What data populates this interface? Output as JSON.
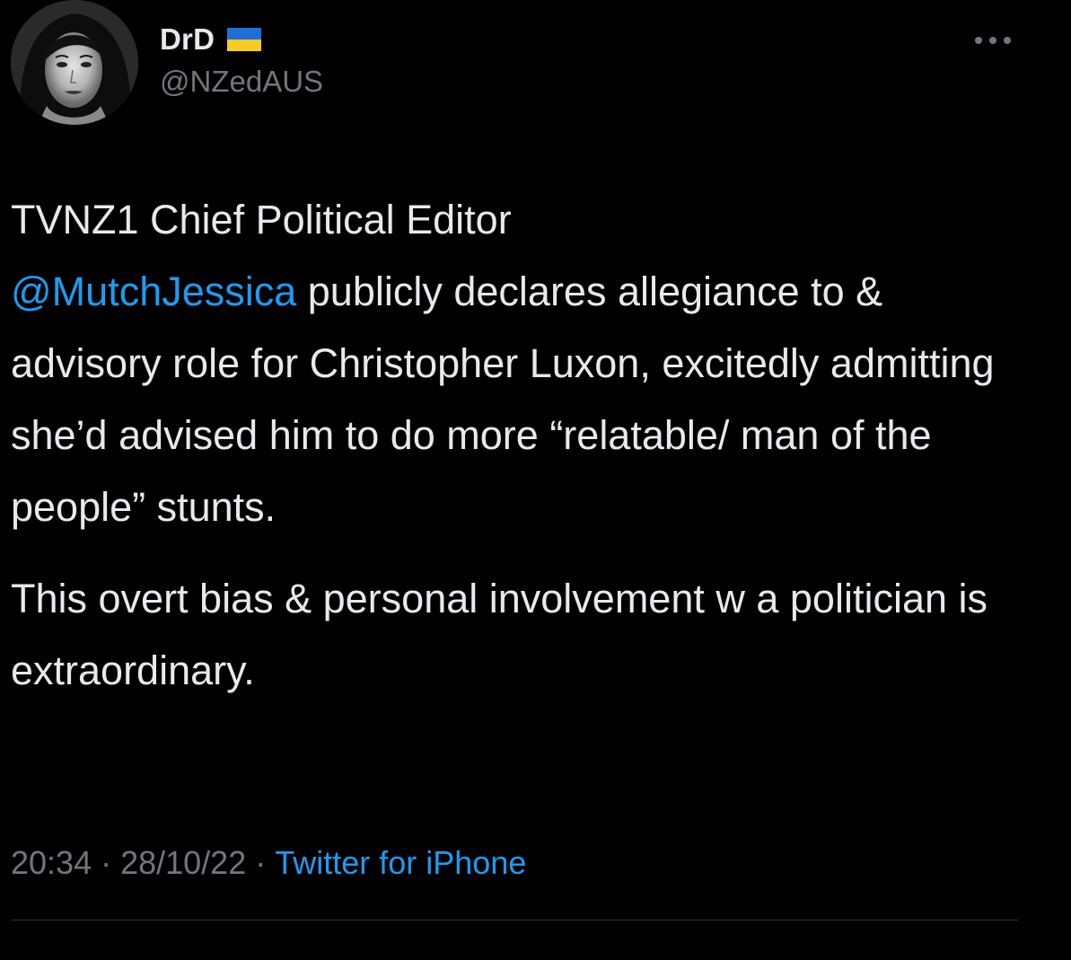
{
  "author": {
    "display_name": "DrD",
    "flag_icon": "ukraine-flag-icon",
    "handle": "@NZedAUS",
    "avatar_icon": "profile-photo"
  },
  "more_icon": "more-horizontal-icon",
  "tweet": {
    "paragraph1": {
      "text_before_mention": "TVNZ1 Chief Political Editor",
      "mention": "@MutchJessica",
      "text_after_mention": " publicly declares allegiance to & advisory role for Christopher Luxon, excitedly admitting she’d advised him to do more “relatable/ man of the people” stunts."
    },
    "paragraph2": "This overt bias & personal involvement w a politician is extraordinary."
  },
  "meta": {
    "time": "20:34",
    "separator": "·",
    "date": "28/10/22",
    "source": "Twitter for iPhone"
  },
  "colors": {
    "background": "#000000",
    "text": "#e7e9ea",
    "muted": "#71767b",
    "link": "#1d9bf0",
    "divider": "#2f3336"
  }
}
